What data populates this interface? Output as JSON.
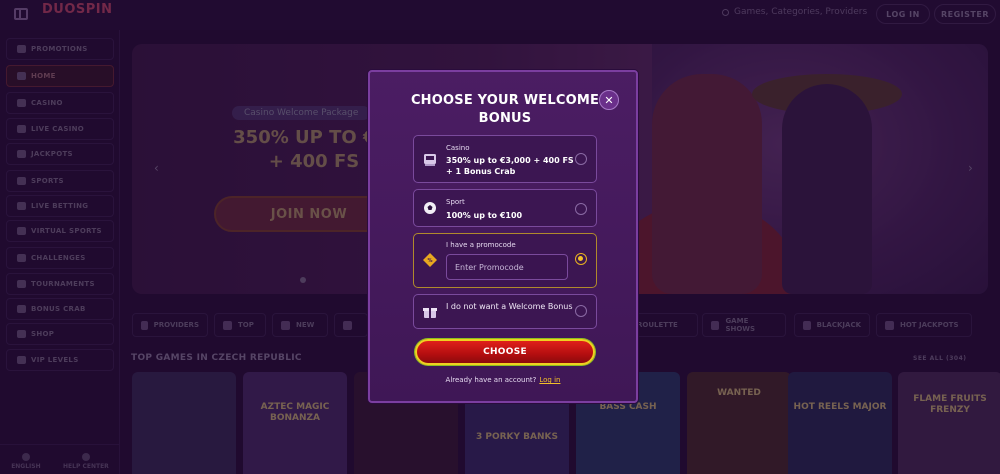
{
  "header": {
    "logo_text": "DUOSPIN",
    "logo_sub": "",
    "search_placeholder": "Games, Categories, Providers",
    "login_label": "LOG IN",
    "register_label": "REGISTER"
  },
  "sidebar": {
    "items": [
      {
        "label": "PROMOTIONS",
        "icon": "gift-icon"
      },
      {
        "label": "HOME",
        "icon": "home-icon"
      },
      {
        "label": "CASINO",
        "icon": "slot-icon"
      },
      {
        "label": "LIVE CASINO",
        "icon": "cards-icon"
      },
      {
        "label": "JACKPOTS",
        "icon": "jackpot-icon"
      },
      {
        "label": "SPORTS",
        "icon": "football-icon"
      },
      {
        "label": "LIVE BETTING",
        "icon": "live-icon"
      },
      {
        "label": "VIRTUAL SPORTS",
        "icon": "virtual-icon"
      },
      {
        "label": "CHALLENGES",
        "icon": "challenge-icon"
      },
      {
        "label": "TOURNAMENTS",
        "icon": "trophy-icon"
      },
      {
        "label": "BONUS CRAB",
        "icon": "crab-icon"
      },
      {
        "label": "SHOP",
        "icon": "shop-icon"
      },
      {
        "label": "VIP LEVELS",
        "icon": "vip-icon"
      }
    ],
    "footer": [
      {
        "label": "ENGLISH"
      },
      {
        "label": "HELP CENTER"
      }
    ]
  },
  "banner": {
    "tag": "Casino Welcome Package",
    "headline_line1": "350% UP TO €3,",
    "headline_line2": "+ 400 FS",
    "cta": "JOIN NOW",
    "prev_arrow": "‹",
    "next_arrow": "›"
  },
  "categories": [
    {
      "label": "PROVIDERS"
    },
    {
      "label": "TOP"
    },
    {
      "label": "NEW"
    },
    {
      "label": "ROULETTE"
    },
    {
      "label": "GAME SHOWS"
    },
    {
      "label": "BLACKJACK"
    },
    {
      "label": "HOT JACKPOTS"
    }
  ],
  "games_section": {
    "title": "TOP GAMES IN CZECH REPUBLIC",
    "see_all": "SEE ALL (304)",
    "games": [
      {
        "title": "",
        "color": "#3a2a5a"
      },
      {
        "title": "AZTEC MAGIC BONANZA",
        "color": "#4a2a6a"
      },
      {
        "title": "",
        "color": "#3a1a3a"
      },
      {
        "title": "3 PORKY BANKS",
        "color": "#3a2a6a"
      },
      {
        "title": "BASS CASH",
        "color": "#2a3a6a"
      },
      {
        "title": "WANTED",
        "color": "#4a2a30"
      },
      {
        "title": "HOT REELS MAJOR",
        "color": "#2a2a5a"
      },
      {
        "title": "FLAME FRUITS FRENZY",
        "color": "#4a2a5a"
      }
    ]
  },
  "modal": {
    "title": "CHOOSE YOUR WELCOME BONUS",
    "close_glyph": "✕",
    "options": [
      {
        "label": "Casino",
        "value": "350% up to €3,000 + 400 FS + 1 Bonus Crab",
        "icon": "slot-machine-icon",
        "selected": false
      },
      {
        "label": "Sport",
        "value": "100% up to €100",
        "icon": "soccer-ball-icon",
        "selected": false
      },
      {
        "label": "I have a promocode",
        "value": "",
        "icon": "promo-tag-icon",
        "selected": true
      },
      {
        "label": "",
        "value": "I do not want a Welcome Bonus",
        "icon": "gift-icon",
        "selected": false
      }
    ],
    "promo_placeholder": "Enter Promocode",
    "choose_label": "CHOOSE",
    "account_text": "Already have an account?",
    "login_link": "Log in"
  },
  "colors": {
    "background": "#2a0f3d",
    "modal_bg": "#4b1d63",
    "accent_yellow": "#f2c02a",
    "cta_red": "#d0181a"
  }
}
